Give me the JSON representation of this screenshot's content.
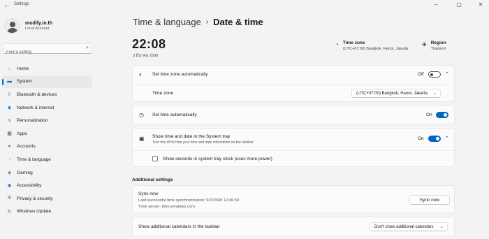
{
  "window": {
    "title": "Settings",
    "back_glyph": "←",
    "minimize_glyph": "–",
    "maximize_glyph": "▢",
    "close_glyph": "✕"
  },
  "profile": {
    "name": "modify.in.th",
    "account_type": "Local Account"
  },
  "search": {
    "placeholder": "Find a setting"
  },
  "nav": {
    "items": [
      {
        "label": "Home",
        "icon": "home-icon",
        "glyph": "⌂",
        "color": "#d08a3a"
      },
      {
        "label": "System",
        "icon": "system-icon",
        "glyph": "▬",
        "color": "#0a72c8"
      },
      {
        "label": "Bluetooth & devices",
        "icon": "bluetooth-icon",
        "glyph": "ᛒ",
        "color": "#0067c0"
      },
      {
        "label": "Network & internet",
        "icon": "wifi-icon",
        "glyph": "◆",
        "color": "#2a86d8"
      },
      {
        "label": "Personalization",
        "icon": "brush-icon",
        "glyph": "✎",
        "color": "#c26d1c"
      },
      {
        "label": "Apps",
        "icon": "apps-icon",
        "glyph": "▦",
        "color": "#555555"
      },
      {
        "label": "Accounts",
        "icon": "accounts-icon",
        "glyph": "●",
        "color": "#2e9c5a"
      },
      {
        "label": "Time & language",
        "icon": "globe-clock-icon",
        "glyph": "◔",
        "color": "#1a7bd4"
      },
      {
        "label": "Gaming",
        "icon": "gaming-icon",
        "glyph": "◈",
        "color": "#666666"
      },
      {
        "label": "Accessibility",
        "icon": "accessibility-icon",
        "glyph": "✱",
        "color": "#1572c7"
      },
      {
        "label": "Privacy & security",
        "icon": "shield-icon",
        "glyph": "⛨",
        "color": "#6b6b6b"
      },
      {
        "label": "Windows Update",
        "icon": "update-icon",
        "glyph": "↻",
        "color": "#0a6ed1"
      }
    ],
    "active_index": 1,
    "accent": "#0067c0"
  },
  "header": {
    "parent": "Time & language",
    "separator": "›",
    "current": "Date & time"
  },
  "clock": {
    "time": "22:08",
    "date": "3 มีนาคม 2568"
  },
  "timezone_info": {
    "title": "Time zone",
    "value": "(UTC+07:00) Bangkok, Hanoi, Jakarta"
  },
  "region_info": {
    "title": "Region",
    "value": "Thailand"
  },
  "settings": {
    "auto_timezone": {
      "label": "Set time zone automatically",
      "state": "Off"
    },
    "timezone": {
      "label": "Time zone",
      "value": "(UTC+07:00) Bangkok, Hanoi, Jakarta"
    },
    "auto_time": {
      "label": "Set time automatically",
      "state": "On"
    },
    "tray": {
      "label": "Show time and date in the System tray",
      "sub": "Turn this off to hide your time and date information on the taskbar",
      "state": "On"
    },
    "seconds": {
      "label": "Show seconds in system tray clock (uses more power)",
      "checked": false
    }
  },
  "additional": {
    "title": "Additional settings",
    "sync": {
      "title": "Sync now",
      "last": "Last successful time synchronization: 9/2/2568 12:49:50",
      "server": "Time server: time.windows.com",
      "button": "Sync now"
    },
    "calendars": {
      "label": "Show additional calendars in the taskbar",
      "value": "Don't show additional calendars"
    }
  },
  "glyphs": {
    "chevron_up": "⌃",
    "chevron_down": "⌄",
    "search": "⌕",
    "clock": "◷",
    "globe": "⊕"
  }
}
